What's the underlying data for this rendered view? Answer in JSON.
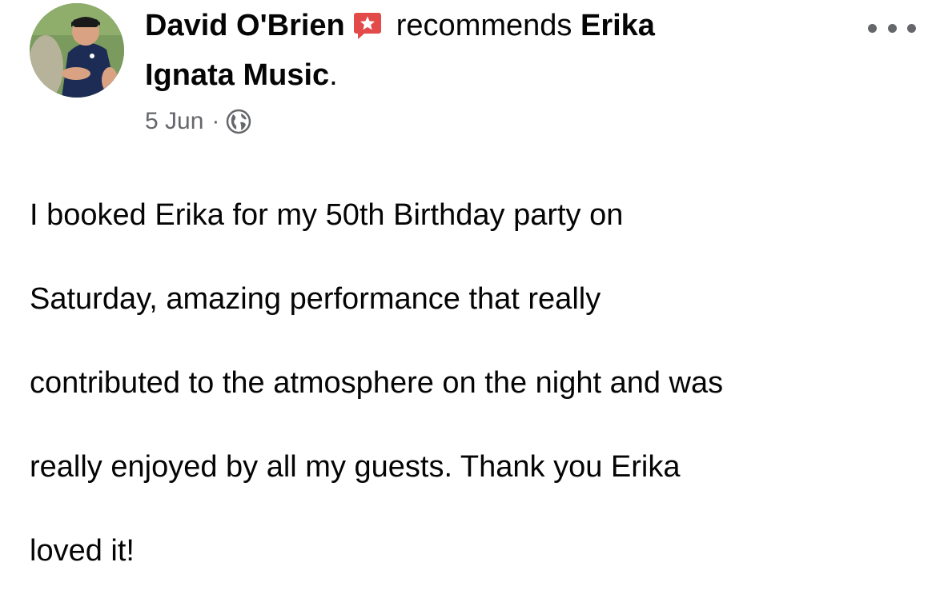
{
  "post": {
    "author_name": "David O'Brien",
    "action_text": "recommends",
    "page_name_part1": "Erika",
    "page_name_part2": "Ignata Music",
    "page_name_suffix": ".",
    "date": "5 Jun",
    "separator": "·",
    "privacy_icon": "globe-icon",
    "recommend_icon": "recommendation-star-icon",
    "more_icon": "more-options-icon",
    "body_lines": [
      "I booked Erika for my 50th Birthday party on",
      "Saturday, amazing performance that really",
      "contributed to the atmosphere on the night and was",
      "really enjoyed by all my guests.  Thank you Erika",
      "loved it!"
    ]
  },
  "colors": {
    "recommend_red": "#e34a4a",
    "secondary_text": "#65676b",
    "primary_text": "#050505"
  }
}
